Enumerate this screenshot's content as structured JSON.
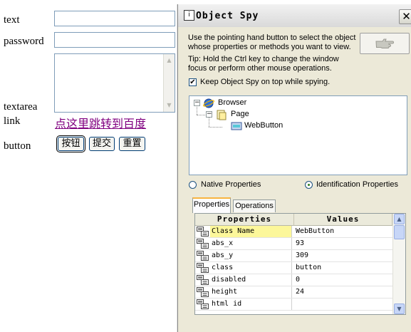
{
  "webpage": {
    "text_label": "text",
    "password_label": "password",
    "textarea_label": "textarea",
    "link_label": "link",
    "link_text": "点这里跳转到百度",
    "button_label": "button",
    "buttons": [
      "按钮",
      "提交",
      "重置"
    ]
  },
  "spy": {
    "title": "Object Spy",
    "close_glyph": "✕",
    "instructions": "Use the pointing hand button to select the object whose properties or methods you want to view.",
    "tip": "Tip: Hold the Ctrl key to change the window focus or perform other mouse operations.",
    "keep_on_top": {
      "label": "Keep Object Spy on top while spying.",
      "checked": true
    },
    "tree": [
      {
        "label": "Browser",
        "icon": "browser-icon",
        "expanded": true
      },
      {
        "label": "Page",
        "icon": "page-icon",
        "expanded": true
      },
      {
        "label": "WebButton",
        "icon": "webbutton-icon",
        "selected": true
      }
    ],
    "radios": {
      "native": "Native Properties",
      "identification": "Identification Properties",
      "selected": "identification"
    },
    "tabs": [
      "Properties",
      "Operations"
    ],
    "active_tab": "Properties",
    "grid": {
      "headers": [
        "Properties",
        "Values"
      ],
      "rows": [
        {
          "name": "Class Name",
          "value": "WebButton",
          "selected": true
        },
        {
          "name": "abs_x",
          "value": "93"
        },
        {
          "name": "abs_y",
          "value": "309"
        },
        {
          "name": "class",
          "value": "button"
        },
        {
          "name": "disabled",
          "value": "0"
        },
        {
          "name": "height",
          "value": "24"
        },
        {
          "name": "html id",
          "value": ""
        }
      ]
    },
    "colors": {
      "selected_row": "#fcf79a",
      "tab_highlight": "#f9b43f",
      "link": "#800080"
    }
  }
}
